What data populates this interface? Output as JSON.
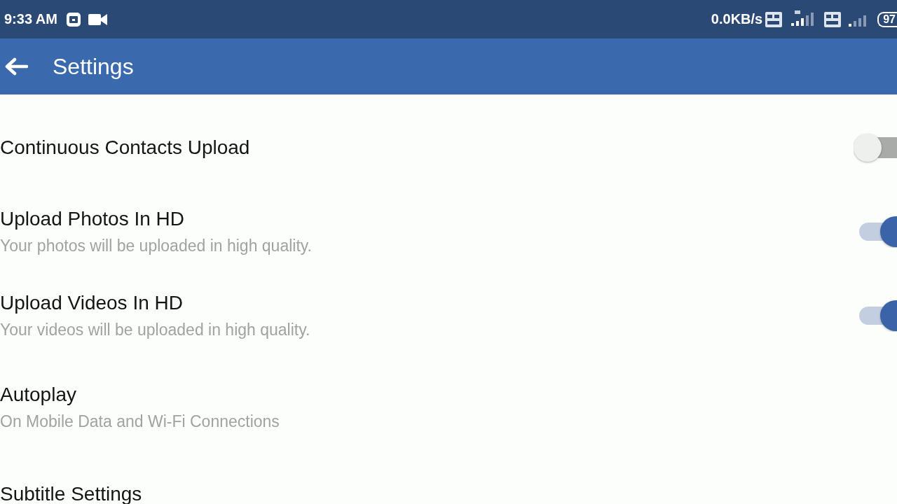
{
  "status_bar": {
    "time": "9:33 AM",
    "speed": "0.0KB/s",
    "battery": "97"
  },
  "app_bar": {
    "title": "Settings"
  },
  "settings": [
    {
      "kind": "toggle",
      "title": "Continuous Contacts Upload",
      "on": false
    },
    {
      "kind": "toggle",
      "title": "Upload Photos In HD",
      "subtitle": "Your photos will be uploaded in high quality.",
      "on": true
    },
    {
      "kind": "toggle",
      "title": "Upload Videos In HD",
      "subtitle": "Your videos will be uploaded in high quality.",
      "on": true
    },
    {
      "kind": "link",
      "title": "Autoplay",
      "subtitle": "On Mobile Data and Wi-Fi Connections"
    },
    {
      "kind": "link",
      "title": "Subtitle Settings"
    }
  ]
}
